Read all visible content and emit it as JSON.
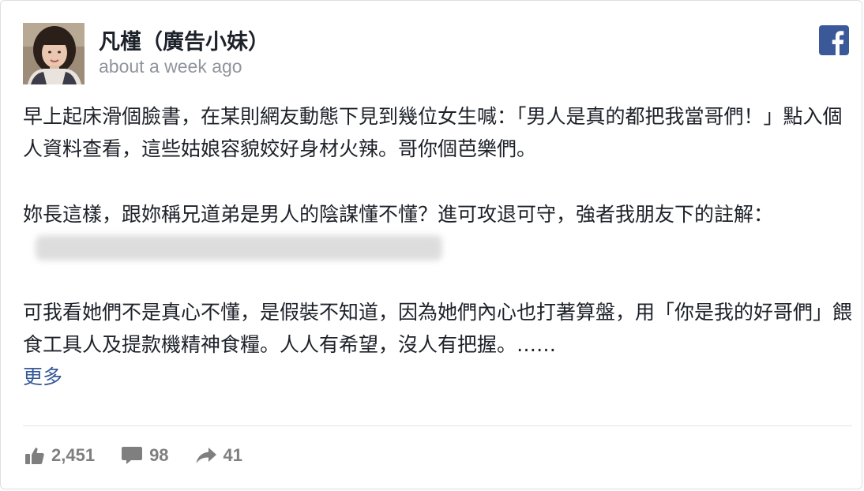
{
  "post": {
    "author": "凡槿（廣告小妹）",
    "timestamp": "about a week ago",
    "paragraphs": {
      "p1": "早上起床滑個臉書，在某則網友動態下見到幾位女生喊：「男人是真的都把我當哥們！」點入個人資料查看，這些姑娘容貌姣好身材火辣。哥你個芭樂們。",
      "p2": "妳長這樣，跟妳稱兄道弟是男人的陰謀懂不懂？進可攻退可守，強者我朋友下的註解：",
      "p3": "可我看她們不是真心不懂，是假裝不知道，因為她們內心也打著算盤，用「你是我的好哥們」餵食工具人及提款機精神食糧。人人有希望，沒人有把握。……"
    },
    "see_more": "更多"
  },
  "stats": {
    "likes": "2,451",
    "comments": "98",
    "shares": "41"
  },
  "icons": {
    "brand": "facebook-logo-icon",
    "like": "thumbs-up-icon",
    "comment": "comment-bubble-icon",
    "share": "share-arrow-icon"
  },
  "colors": {
    "facebook_blue": "#3b5998",
    "link": "#365899",
    "meta_gray": "#90949c",
    "stat_gray": "#7f7f7f"
  }
}
